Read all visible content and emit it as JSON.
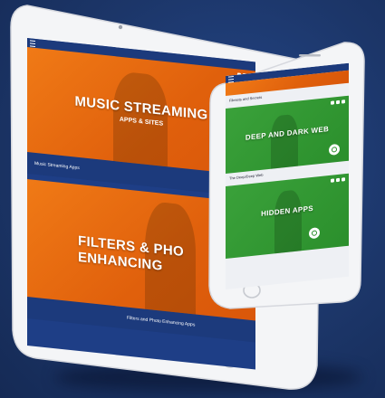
{
  "tablet": {
    "cards": [
      {
        "title": "MUSIC STREAMING",
        "subtitle": "APPS & SITES",
        "caption": "Music Streaming Apps"
      },
      {
        "title_line1": "FILTERS & PHO",
        "title_line2": "ENHANCING",
        "caption": "Filters and Photo Enhancing Apps"
      }
    ]
  },
  "phone": {
    "sections": [
      {
        "label": "Filesets and Secrets",
        "title": "DEEP AND DARK WEB"
      },
      {
        "label": "The Deep/Deep Web",
        "title": "HIDDEN APPS"
      }
    ]
  },
  "colors": {
    "background": "#1f3b74",
    "orange": "#e9690f",
    "green": "#2f972f",
    "device": "#f3f4f6"
  }
}
